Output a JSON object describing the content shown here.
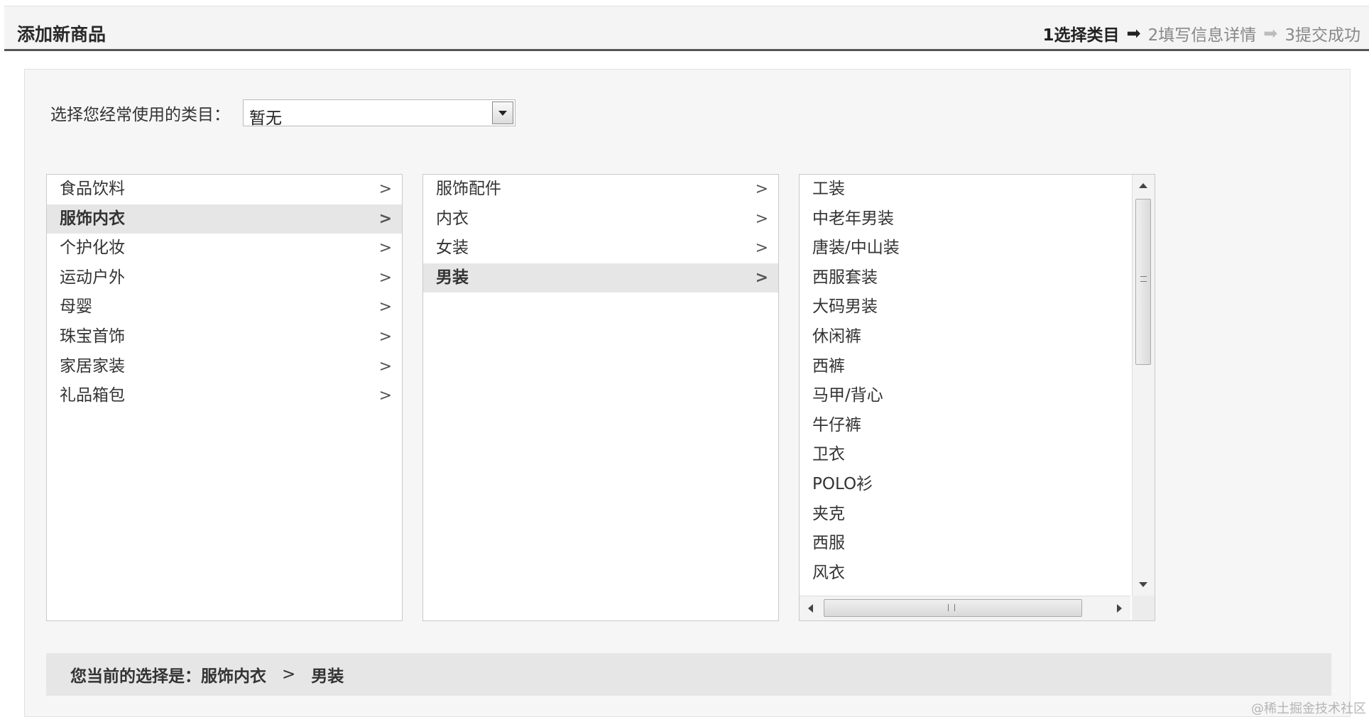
{
  "header": {
    "title": "添加新商品",
    "steps": [
      {
        "label": "1选择类目",
        "active": true
      },
      {
        "label": "2填写信息详情",
        "active": false
      },
      {
        "label": "3提交成功",
        "active": false
      }
    ]
  },
  "common_category": {
    "label": "选择您经常使用的类目：",
    "selected": "暂无"
  },
  "level1": {
    "items": [
      {
        "label": "食品饮料",
        "selected": false
      },
      {
        "label": "服饰内衣",
        "selected": true
      },
      {
        "label": "个护化妆",
        "selected": false
      },
      {
        "label": "运动户外",
        "selected": false
      },
      {
        "label": "母婴",
        "selected": false
      },
      {
        "label": "珠宝首饰",
        "selected": false
      },
      {
        "label": "家居家装",
        "selected": false
      },
      {
        "label": "礼品箱包",
        "selected": false
      }
    ]
  },
  "level2": {
    "items": [
      {
        "label": "服饰配件",
        "selected": false
      },
      {
        "label": "内衣",
        "selected": false
      },
      {
        "label": "女装",
        "selected": false
      },
      {
        "label": "男装",
        "selected": true
      }
    ]
  },
  "level3": {
    "items": [
      "工装",
      "中老年男装",
      "唐装/中山装",
      "西服套装",
      "大码男装",
      "休闲裤",
      "西裤",
      "马甲/背心",
      "牛仔裤",
      "卫衣",
      "POLO衫",
      "夹克",
      "西服",
      "风衣"
    ]
  },
  "current_selection": {
    "label": "您当前的选择是：",
    "level1": "服饰内衣",
    "separator": ">",
    "level2": "男装"
  },
  "icons": {
    "chevron": "chevron-right-icon",
    "step_arrow": "arrow-right-icon"
  },
  "watermark": "@稀土掘金技术社区"
}
